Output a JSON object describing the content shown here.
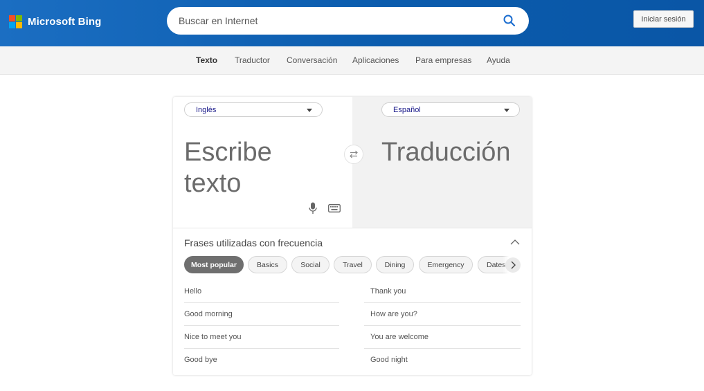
{
  "header": {
    "brand": "Microsoft Bing",
    "search_placeholder": "Buscar en Internet",
    "signin_label": "Iniciar sesión",
    "logo_colors": [
      "#f25022",
      "#7fba00",
      "#00a4ef",
      "#ffb900"
    ]
  },
  "nav": {
    "items": [
      {
        "label": "Texto",
        "active": true
      },
      {
        "label": "Traductor",
        "active": false
      },
      {
        "label": "Conversación",
        "active": false
      },
      {
        "label": "Aplicaciones",
        "active": false
      },
      {
        "label": "Para empresas",
        "active": false
      },
      {
        "label": "Ayuda",
        "active": false
      }
    ]
  },
  "translator": {
    "source_language": "Inglés",
    "target_language": "Español",
    "source_placeholder": "Escribe texto",
    "target_placeholder": "Traducción"
  },
  "phrases": {
    "title": "Frases utilizadas con frecuencia",
    "categories": [
      "Most popular",
      "Basics",
      "Social",
      "Travel",
      "Dining",
      "Emergency",
      "Dates"
    ],
    "active_category": "Most popular",
    "left": [
      "Hello",
      "Good morning",
      "Nice to meet you",
      "Good bye"
    ],
    "right": [
      "Thank you",
      "How are you?",
      "You are welcome",
      "Good night"
    ]
  }
}
